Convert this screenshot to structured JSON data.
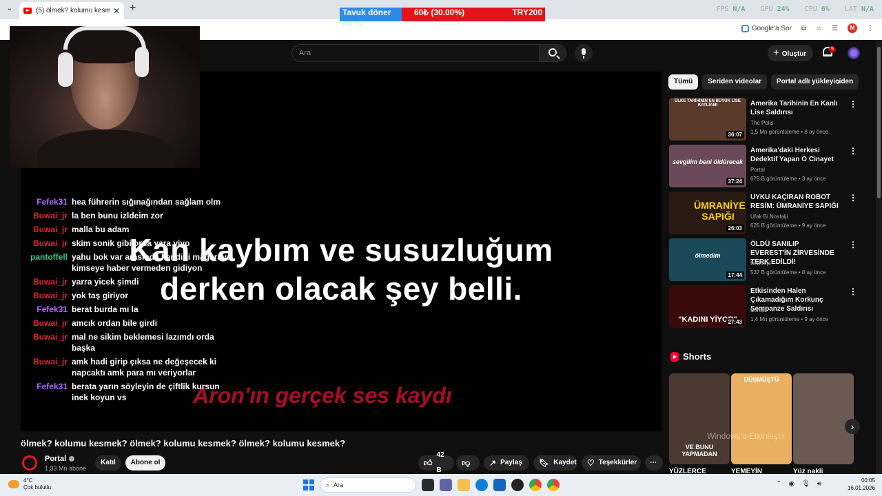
{
  "browser": {
    "tab_title": "(5) ölmek? kolumu kesmek? ölmek?",
    "perf": {
      "fps": "N/A",
      "gpu": "24%",
      "cpu": "6%",
      "lat": "N/A"
    },
    "google_sor": "Google'a Sor",
    "avatar_letter": "M"
  },
  "donation": {
    "item": "Tavuk döner",
    "progress_text": "60₺ (30.00%)",
    "progress_fraction": 0.3,
    "goal": "TRY200",
    "sub": "parası"
  },
  "youtube": {
    "search_placeholder": "Ara",
    "create_label": "Oluştur",
    "notif_count": "5"
  },
  "chat": [
    {
      "user": "Fefek31",
      "cls": "fefek",
      "text": "hea führerin sığınağından sağlam olm"
    },
    {
      "user": "Buwai_jr",
      "cls": "buwai",
      "text": "la ben bunu izldeim zor"
    },
    {
      "user": "Buwai_jr",
      "cls": "buwai",
      "text": "malla bu adam"
    },
    {
      "user": "Buwai_jr",
      "cls": "buwai",
      "text": "skim sonik gibi orda yara yiyo"
    },
    {
      "user": "pantoffell",
      "cls": "pant",
      "text": "yahu bok var arasında kendini mağaraya kimseye haber vermeden gidiyon"
    },
    {
      "user": "Buwai_jr",
      "cls": "buwai",
      "text": "yarra yicek şimdi"
    },
    {
      "user": "Buwai_jr",
      "cls": "buwai",
      "text": "yok taş giriyor"
    },
    {
      "user": "Fefek31",
      "cls": "fefek",
      "text": "berat burda mı la"
    },
    {
      "user": "Buwai_jr",
      "cls": "buwai",
      "text": "amcık ordan bile girdi"
    },
    {
      "user": "Buwai_jr",
      "cls": "buwai",
      "text": "mal ne sikim beklemesi lazımdı orda başka"
    },
    {
      "user": "Buwai_jr",
      "cls": "buwai",
      "text": "amk hadi girip çıksa ne değeşecek ki napcaktı amk para mı veriyorlar"
    },
    {
      "user": "Fefek31",
      "cls": "fefek",
      "text": "berata yarın söyleyin de çiftlik kursun inek koyun vs"
    }
  ],
  "video": {
    "subtitle_line1": "Kan kaybım ve susuzluğum",
    "subtitle_line2": "derken olacak şey belli.",
    "red_caption": "Aron'ın gerçek ses kaydı",
    "title": "ölmek? kolumu kesmek? ölmek? kolumu kesmek? ölmek? kolumu kesmek?",
    "channel": "Portal",
    "subs": "1,33 Mn abone",
    "join": "Katıl",
    "subscribe": "Abone ol",
    "likes": "42 B",
    "share": "Paylaş",
    "save": "Kaydet",
    "thanks": "Teşekkürler"
  },
  "chips": [
    "Tümü",
    "Seriden videolar",
    "Portal adlı yükleyiciden"
  ],
  "recommendations": [
    {
      "title": "Amerika Tarihinin En Kanlı Lise Saldırısı",
      "channel": "The Polis",
      "meta": "1,5 Mn görüntüleme • 8 ay önce",
      "duration": "36:07",
      "thumb_text": "ÜLKE TARİHİNİN EN BÜYÜK LİSE KATLİAMI",
      "bg": "#5a3a2a"
    },
    {
      "title": "Amerika'daki Herkesi Dedektif Yapan O Cinayet",
      "channel": "Portal",
      "meta": "679 B görüntüleme • 3 ay önce",
      "duration": "37:24",
      "thumb_text": "sevgilim beni öldürecek",
      "bg": "#6a4a5a"
    },
    {
      "title": "UYKU KAÇIRAN ROBOT RESİM: ÜMRANİYE SAPIĞI",
      "channel": "Ufak Bi Nostalji",
      "meta": "626 B görüntüleme • 9 ay önce",
      "duration": "26:03",
      "thumb_text": "ÜMRANİYE SAPIĞI",
      "bg": "#2a1a14"
    },
    {
      "title": "ÖLDÜ SANILIP EVEREST'İN ZİRVESİNDE TERK EDİLDİ!",
      "channel": "Bentropi",
      "meta": "537 B görüntüleme • 8 ay önce",
      "duration": "17:44",
      "thumb_text": "ölmedim",
      "bg": "#1a4a5a"
    },
    {
      "title": "Etkisinden Halen Çıkamadığım Korkunç Şempanze Saldırısı",
      "channel": "Portal",
      "meta": "1,4 Mn görüntüleme • 9 ay önce",
      "duration": "27:43",
      "thumb_text": "\"KADINI YİYOR\"",
      "bg": "#3a0a0a"
    }
  ],
  "shorts": {
    "heading": "Shorts",
    "items": [
      {
        "title": "YÜZLERCE",
        "bg": "#4a3a32",
        "overlay": "VE BUNU YAPMADAN"
      },
      {
        "title": "YEMEYİN",
        "bg": "#e8b060",
        "overlay": "DÜŞMÜŞTÜ"
      },
      {
        "title": "Yüz nakli",
        "bg": "#6a5a52",
        "overlay": ""
      }
    ],
    "watermark": "Windows'u Etkinleştir"
  },
  "taskbar": {
    "temp": "4°C",
    "weather": "Çok bulutlu",
    "search": "Ara",
    "time": "00:05",
    "date": "16.01.2026"
  }
}
